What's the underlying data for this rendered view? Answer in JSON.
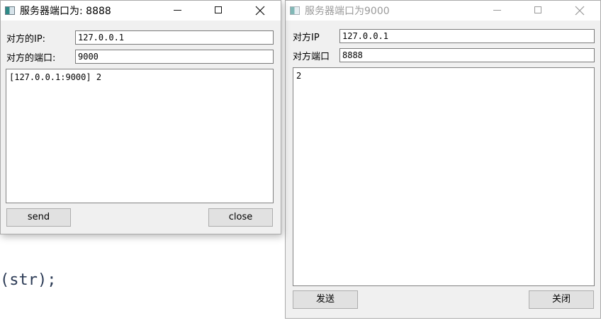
{
  "background": {
    "code_fragment": "(str);"
  },
  "window_left": {
    "title": "服务器端口为: 8888",
    "ip_label": "对方的IP:",
    "ip_value": "127.0.0.1",
    "port_label": "对方的端口:",
    "port_value": "9000",
    "messages": "[127.0.0.1:9000] 2",
    "send_label": "send",
    "close_label": "close"
  },
  "window_right": {
    "title": "服务器端口为9000",
    "ip_label": "对方IP",
    "ip_value": "127.0.0.1",
    "port_label": "对方端口",
    "port_value": "8888",
    "messages": "2",
    "send_label": "发送",
    "close_label": "关闭"
  }
}
